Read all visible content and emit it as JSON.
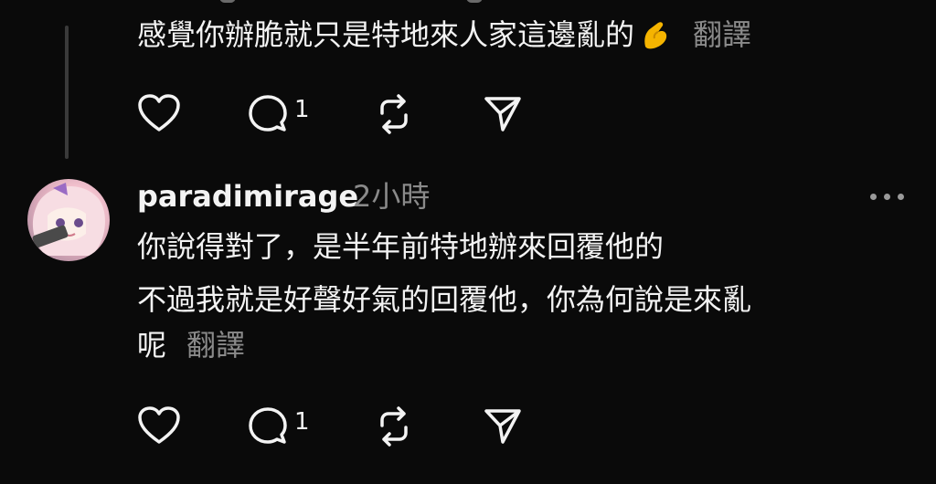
{
  "first_post": {
    "text": "感覺你辦脆就只是特地來人家這邊亂的",
    "translate_label": "翻譯",
    "reply_count": "1"
  },
  "reply_post": {
    "username": "paradimirage",
    "time_ago": "2小時",
    "lines": [
      "你說得對了，是半年前特地辦來回覆他的",
      "不過我就是好聲好氣的回覆他，你為何說是來亂",
      "呢"
    ],
    "translate_label": "翻譯",
    "reply_count": "1"
  },
  "icons": [
    "heart-icon",
    "comment-icon",
    "repost-icon",
    "share-icon",
    "more-icon",
    "pinching-hand-emoji"
  ]
}
